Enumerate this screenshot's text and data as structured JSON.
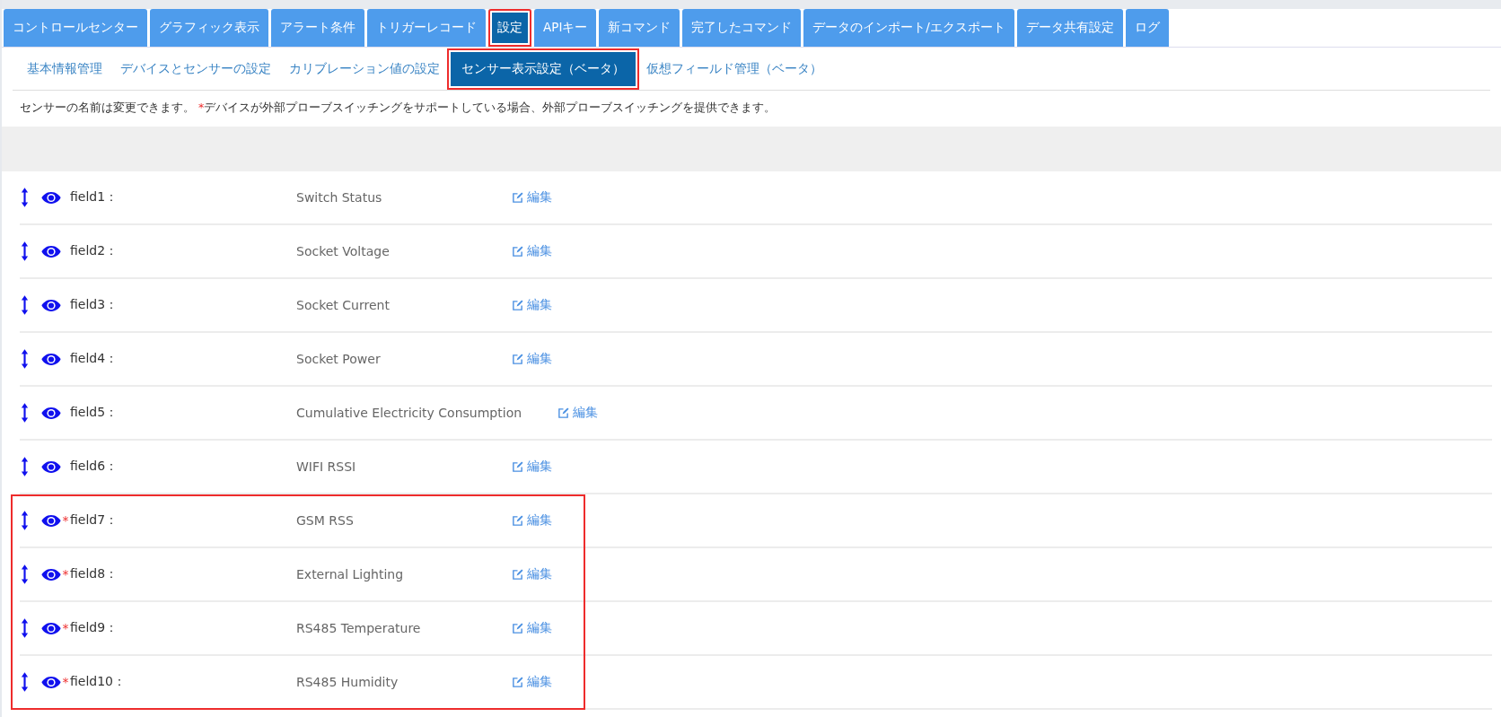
{
  "tabs": [
    {
      "label": "コントロールセンター",
      "selected": false,
      "highlighted": false
    },
    {
      "label": "グラフィック表示",
      "selected": false,
      "highlighted": false
    },
    {
      "label": "アラート条件",
      "selected": false,
      "highlighted": false
    },
    {
      "label": "トリガーレコード",
      "selected": false,
      "highlighted": false
    },
    {
      "label": "設定",
      "selected": true,
      "highlighted": true
    },
    {
      "label": "APIキー",
      "selected": false,
      "highlighted": false
    },
    {
      "label": "新コマンド",
      "selected": false,
      "highlighted": false
    },
    {
      "label": "完了したコマンド",
      "selected": false,
      "highlighted": false
    },
    {
      "label": "データのインポート/エクスポート",
      "selected": false,
      "highlighted": false
    },
    {
      "label": "データ共有設定",
      "selected": false,
      "highlighted": false
    },
    {
      "label": "ログ",
      "selected": false,
      "highlighted": false
    }
  ],
  "subtabs": [
    {
      "label": "基本情報管理",
      "selected": false,
      "highlighted": false
    },
    {
      "label": "デバイスとセンサーの設定",
      "selected": false,
      "highlighted": false
    },
    {
      "label": "カリブレーション値の設定",
      "selected": false,
      "highlighted": false
    },
    {
      "label": "センサー表示設定（ベータ）",
      "selected": true,
      "highlighted": true
    },
    {
      "label": "仮想フィールド管理（ベータ）",
      "selected": false,
      "highlighted": false
    }
  ],
  "note": {
    "intro": "センサーの名前は変更できます。",
    "mark": "*",
    "detail": "デバイスが外部プローブスイッチングをサポートしている場合、外部プローブスイッチングを提供できます。"
  },
  "sensor_groups": [
    {
      "highlighted": false,
      "rows": [
        {
          "field": "field1：",
          "starred": false,
          "name": "Switch Status",
          "edit": "編集"
        },
        {
          "field": "field2：",
          "starred": false,
          "name": "Socket Voltage",
          "edit": "編集"
        },
        {
          "field": "field3：",
          "starred": false,
          "name": "Socket Current",
          "edit": "編集"
        },
        {
          "field": "field4：",
          "starred": false,
          "name": "Socket Power",
          "edit": "編集"
        },
        {
          "field": "field5：",
          "starred": false,
          "name": "Cumulative Electricity Consumption",
          "edit": "編集"
        },
        {
          "field": "field6：",
          "starred": false,
          "name": "WIFI RSSI",
          "edit": "編集"
        }
      ]
    },
    {
      "highlighted": true,
      "rows": [
        {
          "field": "field7：",
          "starred": true,
          "name": "GSM RSS",
          "edit": "編集"
        },
        {
          "field": "field8：",
          "starred": true,
          "name": "External Lighting",
          "edit": "編集"
        },
        {
          "field": "field9：",
          "starred": true,
          "name": "RS485 Temperature",
          "edit": "編集"
        },
        {
          "field": "field10：",
          "starred": true,
          "name": "RS485 Humidity",
          "edit": "編集"
        }
      ]
    }
  ]
}
